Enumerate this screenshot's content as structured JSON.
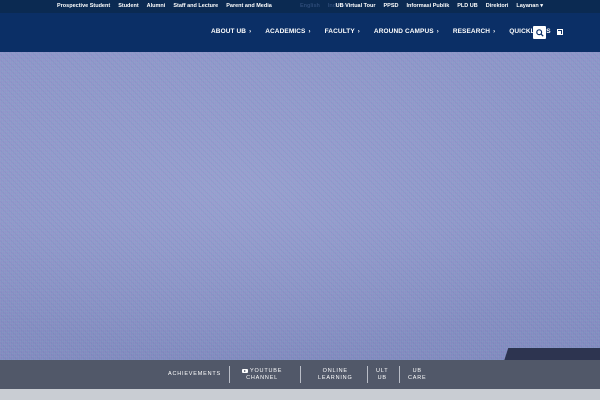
{
  "topbar": {
    "left_links": [
      "Prospective Student",
      "Student",
      "Alumni",
      "Staff and Lecture",
      "Parent and Media"
    ],
    "mid_links": [
      "English",
      "Indonesia"
    ],
    "right_links": [
      "UB Virtual Tour",
      "PPSD",
      "Informasi Publik",
      "PLD UB",
      "Direktori"
    ],
    "dropdown_label": "Layanan",
    "dropdown_caret": "▾"
  },
  "nav": {
    "items": [
      {
        "label": "ABOUT UB",
        "icon": "chevron-right-icon"
      },
      {
        "label": "ACADEMICS",
        "icon": "chevron-right-icon"
      },
      {
        "label": "FACULTY",
        "icon": "chevron-right-icon"
      },
      {
        "label": "AROUND CAMPUS",
        "icon": "chevron-right-icon"
      },
      {
        "label": "RESEARCH",
        "icon": "chevron-right-icon"
      },
      {
        "label": "QUICKLINKS",
        "icon": "external-link-icon"
      }
    ],
    "chevron_glyph": "›",
    "search_icon": "search-icon"
  },
  "quickbar": {
    "items": [
      {
        "line1": "ACHIEVEMENTS",
        "line2": ""
      },
      {
        "line1": "YOUTUBE",
        "line2": "CHANNEL",
        "icon": "youtube-icon"
      },
      {
        "line1": "ONLINE",
        "line2": "LEARNING"
      },
      {
        "line1": "ULT",
        "line2": "UB"
      },
      {
        "line1": "UB",
        "line2": "CARE"
      }
    ]
  },
  "colors": {
    "topbar": "#0b2a52",
    "nav": "#0b2f66",
    "quickbar": "#464e5f"
  }
}
